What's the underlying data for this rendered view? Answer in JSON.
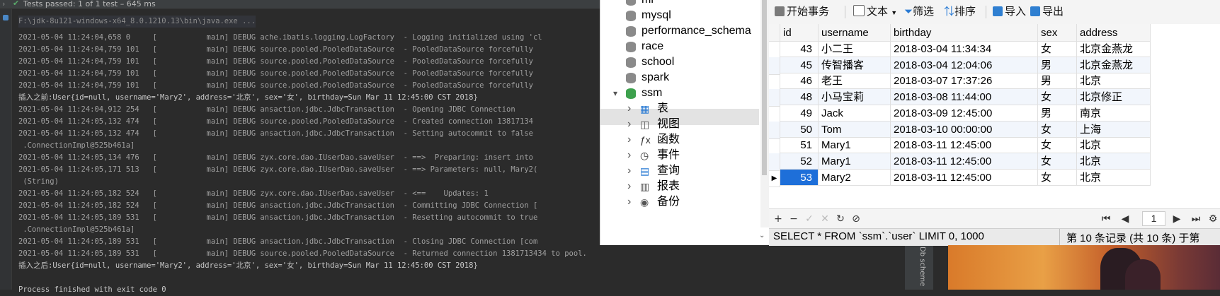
{
  "ide": {
    "status_text": "Tests passed: 1 of 1 test – 645 ms",
    "run_panel_label": "Db scheme",
    "console_lines": [
      "F:\\jdk-8u121-windows-x64_8.0.1210.13\\bin\\java.exe ...",
      "2021-05-04 11:24:04,658 0     [           main] DEBUG ache.ibatis.logging.LogFactory  - Logging initialized using 'cl",
      "2021-05-04 11:24:04,759 101   [           main] DEBUG source.pooled.PooledDataSource  - PooledDataSource forcefully",
      "2021-05-04 11:24:04,759 101   [           main] DEBUG source.pooled.PooledDataSource  - PooledDataSource forcefully",
      "2021-05-04 11:24:04,759 101   [           main] DEBUG source.pooled.PooledDataSource  - PooledDataSource forcefully",
      "2021-05-04 11:24:04,759 101   [           main] DEBUG source.pooled.PooledDataSource  - PooledDataSource forcefully",
      "插入之前:User{id=null, username='Mary2', address='北京', sex='女', birthday=Sun Mar 11 12:45:00 CST 2018}",
      "2021-05-04 11:24:04,912 254   [           main] DEBUG ansaction.jdbc.JdbcTransaction  - Opening JDBC Connection",
      "2021-05-04 11:24:05,132 474   [           main] DEBUG source.pooled.PooledDataSource  - Created connection 13817134",
      "2021-05-04 11:24:05,132 474   [           main] DEBUG ansaction.jdbc.JdbcTransaction  - Setting autocommit to false",
      " .ConnectionImpl@525b461a]",
      "2021-05-04 11:24:05,134 476   [           main] DEBUG zyx.core.dao.IUserDao.saveUser  - ==>  Preparing: insert into",
      "2021-05-04 11:24:05,171 513   [           main] DEBUG zyx.core.dao.IUserDao.saveUser  - ==> Parameters: null, Mary2(",
      " (String)",
      "2021-05-04 11:24:05,182 524   [           main] DEBUG zyx.core.dao.IUserDao.saveUser  - <==    Updates: 1",
      "2021-05-04 11:24:05,182 524   [           main] DEBUG ansaction.jdbc.JdbcTransaction  - Committing JDBC Connection [",
      "2021-05-04 11:24:05,189 531   [           main] DEBUG ansaction.jdbc.JdbcTransaction  - Resetting autocommit to true",
      " .ConnectionImpl@525b461a]",
      "2021-05-04 11:24:05,189 531   [           main] DEBUG ansaction.jdbc.JdbcTransaction  - Closing JDBC Connection [com",
      "2021-05-04 11:24:05,189 531   [           main] DEBUG source.pooled.PooledDataSource  - Returned connection 1381713434 to pool.",
      "插入之后:User{id=null, username='Mary2', address='北京', sex='女', birthday=Sun Mar 11 12:45:00 CST 2018}",
      "",
      "Process finished with exit code 0"
    ]
  },
  "tree": {
    "databases": [
      "mi",
      "mysql",
      "performance_schema",
      "race",
      "school",
      "spark",
      "ssm"
    ],
    "ssm_children": [
      "表",
      "视图",
      "函数",
      "事件",
      "查询",
      "报表",
      "备份"
    ]
  },
  "toolbar": {
    "begin_tx": "开始事务",
    "text": "文本",
    "filter": "筛选",
    "sort": "排序",
    "import": "导入",
    "export": "导出"
  },
  "grid": {
    "columns": [
      "id",
      "username",
      "birthday",
      "sex",
      "address"
    ],
    "rows": [
      [
        "43",
        "小二王",
        "2018-03-04 11:34:34",
        "女",
        "北京金燕龙"
      ],
      [
        "45",
        "传智播客",
        "2018-03-04 12:04:06",
        "男",
        "北京金燕龙"
      ],
      [
        "46",
        "老王",
        "2018-03-07 17:37:26",
        "男",
        "北京"
      ],
      [
        "48",
        "小马宝莉",
        "2018-03-08 11:44:00",
        "女",
        "北京修正"
      ],
      [
        "49",
        "Jack",
        "2018-03-09 12:45:00",
        "男",
        "南京"
      ],
      [
        "50",
        "Tom",
        "2018-03-10 00:00:00",
        "女",
        "上海"
      ],
      [
        "51",
        "Mary1",
        "2018-03-11 12:45:00",
        "女",
        "北京"
      ],
      [
        "52",
        "Mary1",
        "2018-03-11 12:45:00",
        "女",
        "北京"
      ],
      [
        "53",
        "Mary2",
        "2018-03-11 12:45:00",
        "女",
        "北京"
      ]
    ]
  },
  "pager": {
    "page": "1"
  },
  "status": {
    "sql": "SELECT * FROM `ssm`.`user` LIMIT 0, 1000",
    "records": "第 10 条记录 (共 10 条) 于第"
  }
}
